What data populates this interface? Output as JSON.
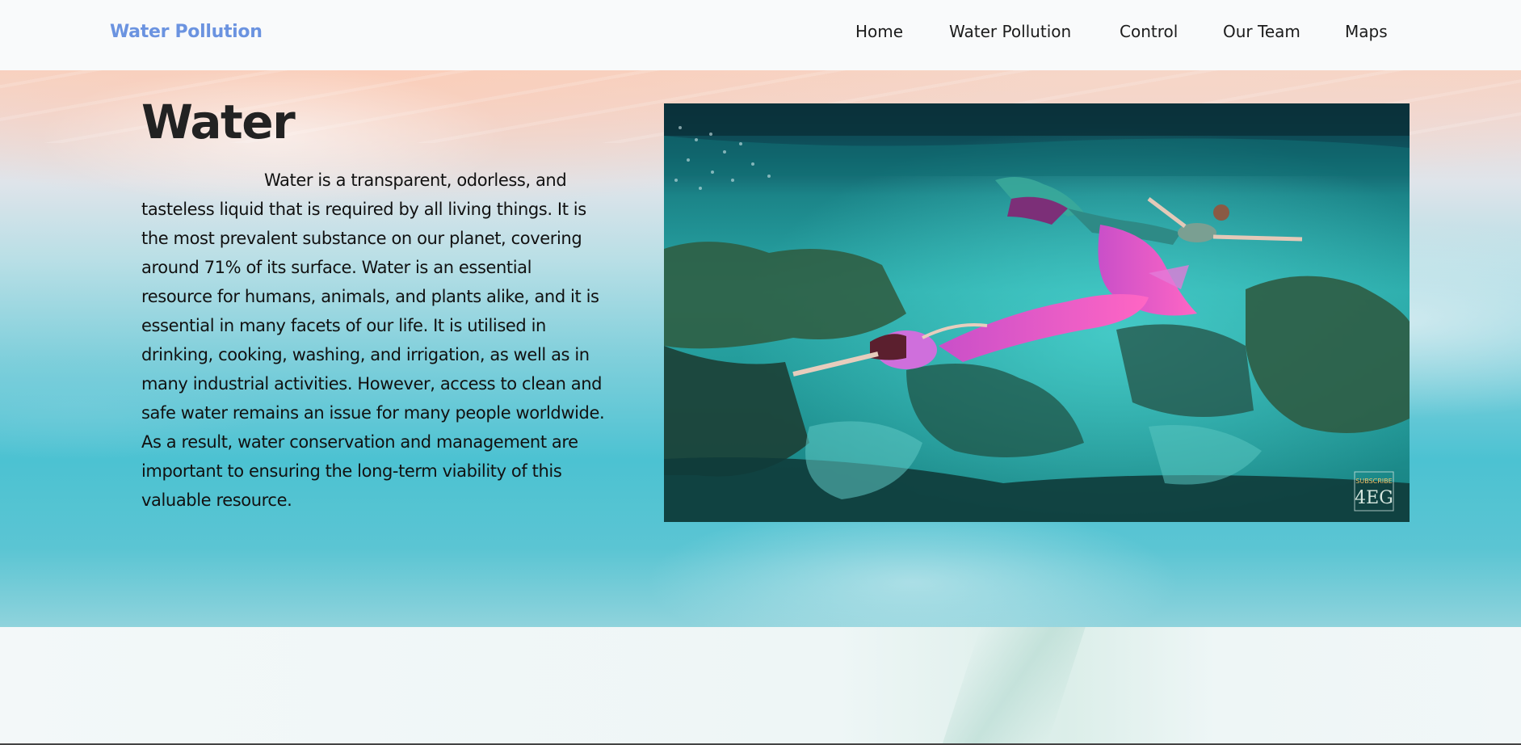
{
  "navbar": {
    "brand": "Water Pollution",
    "links": [
      {
        "label": "Home"
      },
      {
        "label": "Water Pollution"
      },
      {
        "label": "Control"
      },
      {
        "label": "Our Team"
      },
      {
        "label": "Maps"
      }
    ]
  },
  "hero": {
    "heading": "Water",
    "paragraph": "Water is a transparent, odorless, and tasteless liquid that is required by all living things. It is the most prevalent substance on our planet, covering around 71% of its surface. Water is an essential resource for humans, animals, and plants alike, and it is essential in many facets of our life. It is utilised in drinking, cooking, washing, and irrigation, as well as in many industrial activities. However, access to clean and safe water remains an issue for many people worldwide. As a result, water conservation and management are important to ensuring the long-term viability of this valuable resource.",
    "video": {
      "watermark_top": "SUBSCRIBE",
      "watermark_logo": "4EG"
    }
  },
  "colors": {
    "brand": "#6b93e0",
    "text": "#111111",
    "water": "#4cc2d2",
    "sand": "#f6d3c3"
  }
}
